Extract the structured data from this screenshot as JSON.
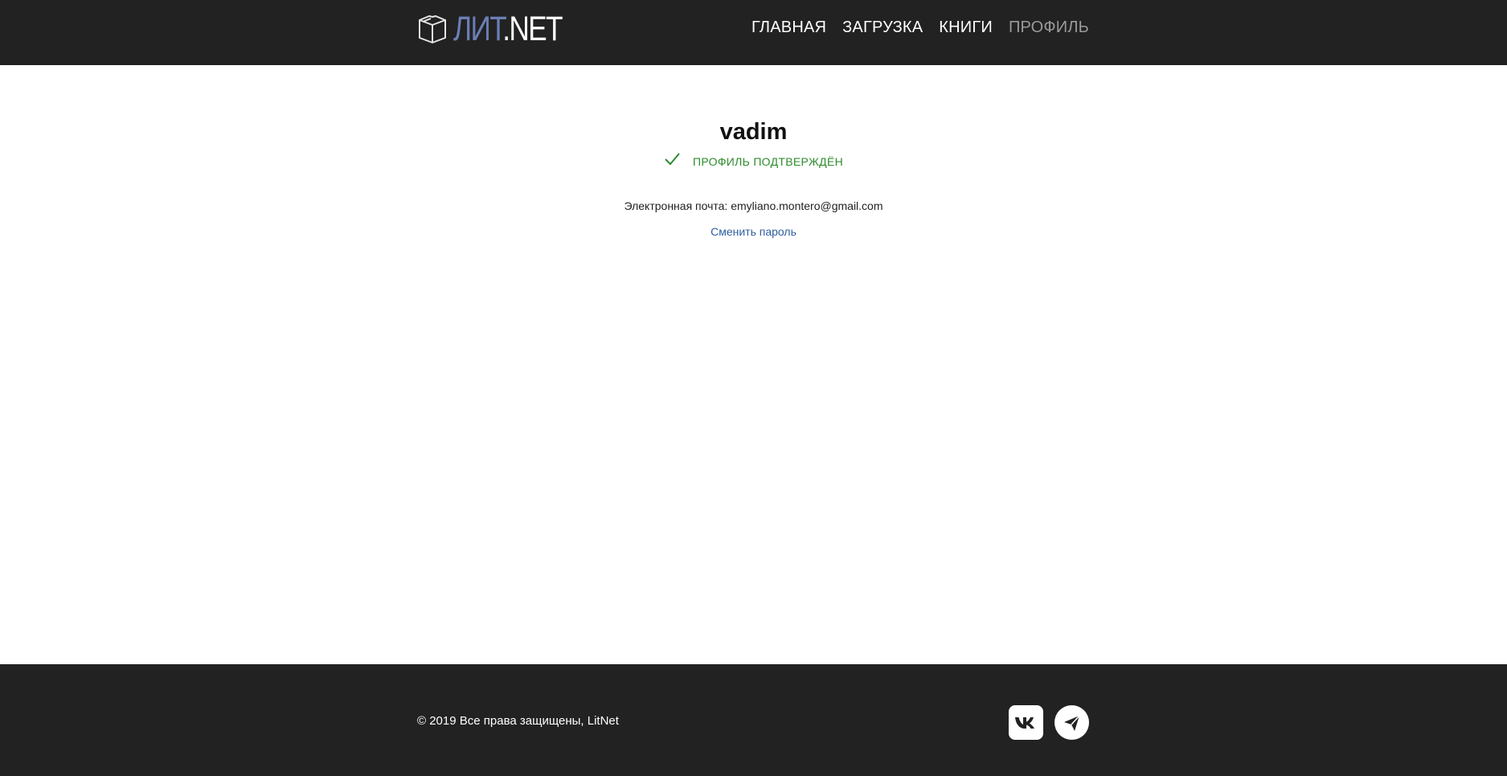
{
  "header": {
    "logo": {
      "part1": "ЛИТ",
      "part2": ".NET",
      "icon": "book-icon"
    },
    "nav": [
      {
        "label": "ГЛАВНАЯ",
        "active": false
      },
      {
        "label": "ЗАГРУЗКА",
        "active": false
      },
      {
        "label": "КНИГИ",
        "active": false
      },
      {
        "label": "ПРОФИЛЬ",
        "active": true
      }
    ]
  },
  "profile": {
    "username": "vadim",
    "verified_icon": "checkmark-icon",
    "verified_text": "ПРОФИЛЬ ПОДТВЕРЖДЁН",
    "email_label": "Электронная почта:",
    "email_value": "emyliano.montero@gmail.com",
    "change_password": "Сменить пароль"
  },
  "footer": {
    "copyright": "© 2019 Все права защищены, LitNet",
    "socials": [
      {
        "name": "vk-icon"
      },
      {
        "name": "telegram-icon"
      }
    ]
  },
  "colors": {
    "header_bg": "#222222",
    "logo_accent": "#6b7fb5",
    "verified_green": "#2e8b2e",
    "link_blue": "#2f5f9f",
    "nav_active": "#9a9a9a"
  }
}
